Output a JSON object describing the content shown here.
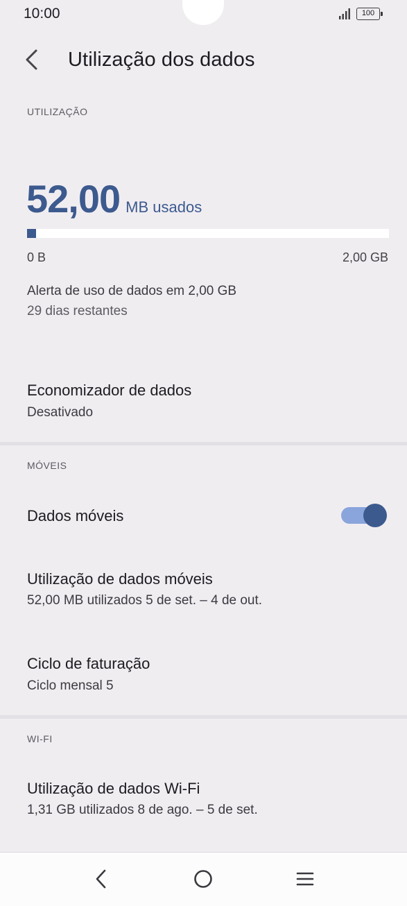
{
  "status_bar": {
    "time": "10:00",
    "battery": "100",
    "icons": [
      "signal-icon",
      "battery-icon"
    ]
  },
  "header": {
    "title": "Utilização dos dados",
    "back_icon": "chevron-left-icon"
  },
  "usage_section": {
    "label": "UTILIZAÇÃO",
    "amount": "52,00",
    "unit": "MB usados",
    "progress_fraction": 0.025,
    "range_min": "0 B",
    "range_max": "2,00 GB",
    "alert_text": "Alerta de uso de dados em 2,00 GB",
    "days_remaining": "29 dias restantes"
  },
  "data_saver": {
    "title": "Economizador de dados",
    "status": "Desativado"
  },
  "mobile_section": {
    "label": "MÓVEIS",
    "mobile_data": {
      "title": "Dados móveis",
      "enabled": true
    },
    "mobile_usage": {
      "title": "Utilização de dados móveis",
      "summary": "52,00 MB utilizados 5 de set. – 4 de out."
    },
    "billing_cycle": {
      "title": "Ciclo de faturação",
      "value": "Ciclo mensal 5"
    }
  },
  "wifi_section": {
    "label": "WI-FI",
    "wifi_usage": {
      "title": "Utilização de dados Wi-Fi",
      "summary": "1,31 GB utilizados 8 de ago. – 5 de set."
    }
  },
  "nav_bar": {
    "icons": [
      "back-nav-icon",
      "home-nav-icon",
      "recents-menu-icon"
    ]
  },
  "colors": {
    "background": "#f0edf1",
    "accent": "#3c5a8e",
    "toggle_track": "#8aa4dc",
    "divider": "#e3e0e5"
  }
}
